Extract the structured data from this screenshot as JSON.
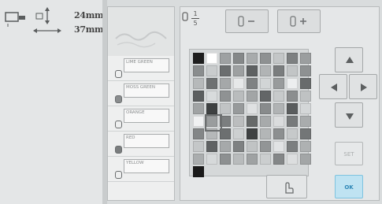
{
  "dimensions": {
    "height": "24mm",
    "width": "37mm"
  },
  "threads": [
    {
      "label": "LIME GREEN"
    },
    {
      "label": "MOSS GREEN"
    },
    {
      "label": "ORANGE"
    },
    {
      "label": "RED"
    },
    {
      "label": "YELLOW"
    }
  ],
  "toolbar": {
    "numerator": "1",
    "denominator": "5"
  },
  "palette": {
    "rows": [
      [
        "#1e1e1e",
        "#ffffff",
        "#9ea1a2",
        "#858889",
        "#a8abac",
        "#8e9192",
        "#c3c6c7",
        "#7d8081",
        "#9b9e9f"
      ],
      [
        "#8a8d8e",
        "#c9cccd",
        "#6b6e6f",
        "#9da0a1",
        "#5e6162",
        "#b1b4b5",
        "#7a7d7e",
        "#c2c5c6",
        "#8e9192"
      ],
      [
        "#b6b9ba",
        "#6e7172",
        "#a5a8a9",
        "#e6e8e9",
        "#7f8283",
        "#d2d5d6",
        "#989b9c",
        "#eceeef",
        "#686b6c"
      ],
      [
        "#5b5e5f",
        "#d8dbdc",
        "#8f9293",
        "#b9bcbd",
        "#a2a5a6",
        "#636667",
        "#c7cacb",
        "#8b8e8f",
        "#bfc2c3"
      ],
      [
        "#a0a3a4",
        "#3e4142",
        "#c1c4c5",
        "#979a9b",
        "#dfe1e2",
        "#888b8c",
        "#b0b3b4",
        "#5a5d5e",
        "#d4d7d8"
      ],
      [
        "#f0f1f2",
        "#9a9d9e",
        "#7b7e7f",
        "#bbbdbe",
        "#666969",
        "#a7aaab",
        "#dadcdd",
        "#777a7b",
        "#a9acad"
      ],
      [
        "#83868 7",
        "#b5b8b9",
        "#6c6f70",
        "#cdd0d1",
        "#3f4243",
        "#b3b6b7",
        "#8c8f90",
        "#c6c9ca",
        "#737677"
      ],
      [
        "#c4c7c8",
        "#5f6263",
        "#a6a9aa",
        "#7e8182",
        "#c0c3c4",
        "#929596",
        "#e1e3e4",
        "#7c7f80",
        "#aeb1b2"
      ],
      [
        "#aaadae",
        "#d6d9da",
        "#8d9091",
        "#b8bbbc",
        "#9fa2a3",
        "#cbcecf",
        "#848788",
        "#dcdedf",
        "#a3a6a7"
      ],
      [
        "#1a1a1a"
      ]
    ]
  },
  "buttons": {
    "set": "SET",
    "ok": "OK"
  }
}
